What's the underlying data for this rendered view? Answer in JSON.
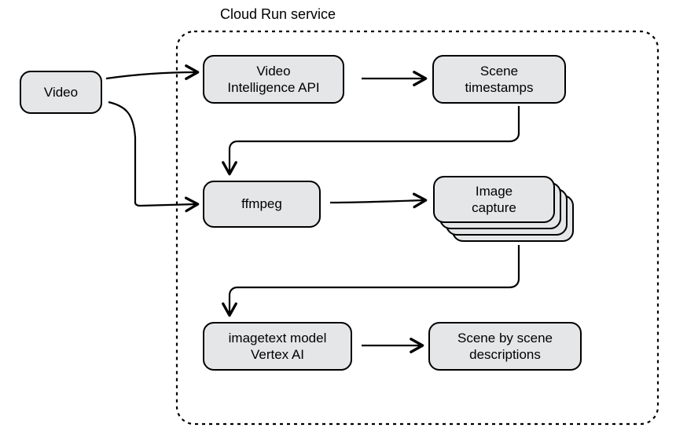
{
  "container": {
    "label": "Cloud Run service"
  },
  "nodes": {
    "video": "Video",
    "video_intel": "Video\nIntelligence API",
    "scene_ts": "Scene\ntimestamps",
    "ffmpeg": "ffmpeg",
    "image_capture": "Image\ncapture",
    "imagetext": "imagetext model\nVertex AI",
    "scene_desc": "Scene by scene\ndescriptions"
  }
}
